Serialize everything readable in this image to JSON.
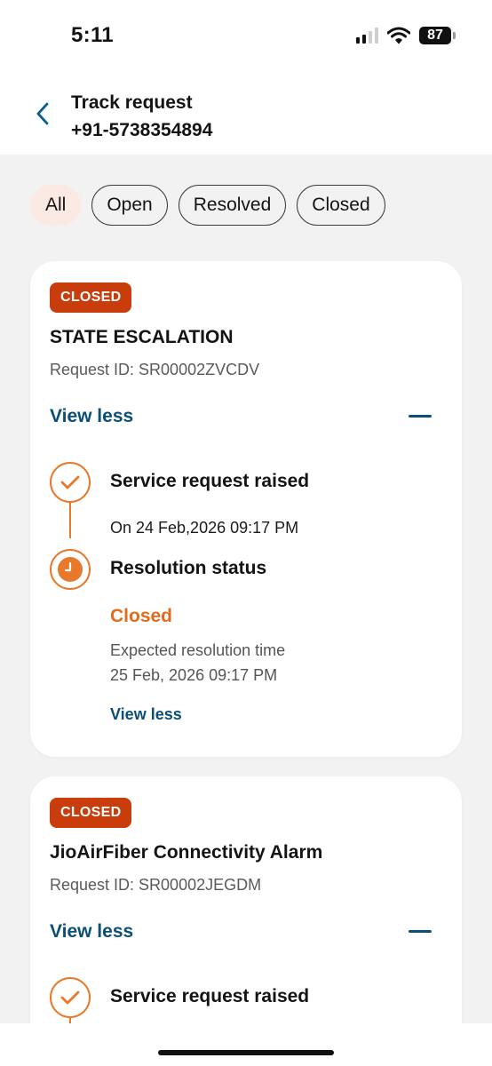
{
  "status_bar": {
    "time": "5:11",
    "battery": "87",
    "icons": [
      "signal-icon",
      "wifi-icon",
      "battery-icon"
    ]
  },
  "header": {
    "title": "Track request",
    "subtitle": "+91-5738354894",
    "back_icon": "chevron-left-icon"
  },
  "filters": {
    "selected": "All",
    "chips": [
      "All",
      "Open",
      "Resolved",
      "Closed"
    ]
  },
  "requests": [
    {
      "status_badge": "CLOSED",
      "title": "STATE ESCALATION",
      "request_id": "Request ID: SR00002ZVCDV",
      "toggle_label": "View less",
      "timeline": {
        "step1_title": "Service request raised",
        "step1_date": "On 24 Feb,2026 09:17 PM",
        "step2_title": "Resolution status",
        "step2_status": "Closed",
        "expected_label": "Expected resolution time",
        "expected_time": "25 Feb, 2026 09:17 PM",
        "inner_toggle": "View less"
      }
    },
    {
      "status_badge": "CLOSED",
      "title": "JioAirFiber Connectivity Alarm",
      "request_id": "Request ID: SR00002JEGDM",
      "toggle_label": "View less",
      "timeline": {
        "step1_title": "Service request raised"
      }
    }
  ],
  "colors": {
    "accent_orange": "#e8782a",
    "badge_red": "#c93c0c",
    "link_blue": "#0a4f78",
    "chip_active_bg": "#fbeae3"
  }
}
